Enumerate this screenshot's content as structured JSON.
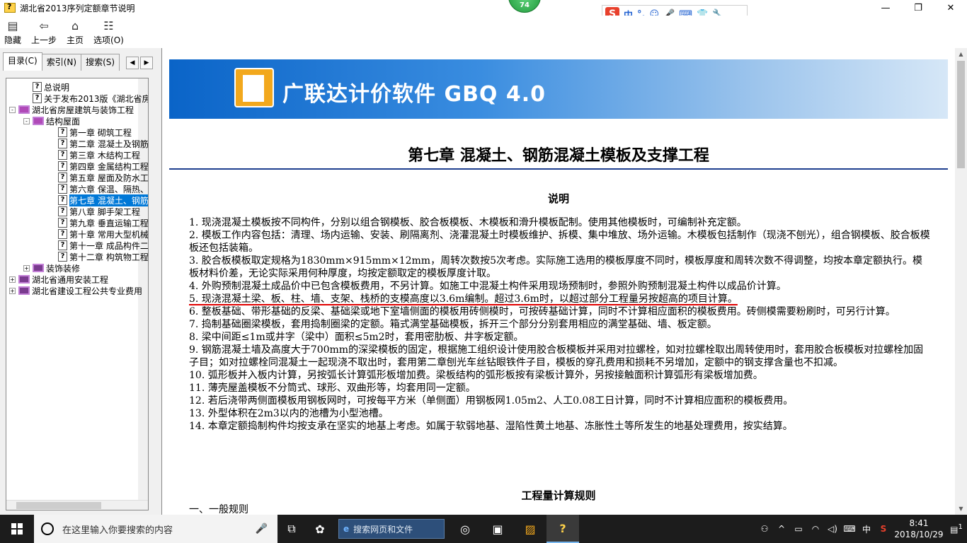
{
  "window": {
    "title": "湖北省2013序列定额章节说明",
    "badge": "74"
  },
  "ime": {
    "logo": "S",
    "items": [
      "中",
      "°,",
      "☺",
      "🎤",
      "⌨",
      "👕",
      "🔧"
    ]
  },
  "toolbar": {
    "buttons": [
      {
        "label": "隐藏",
        "icon": "hide-icon"
      },
      {
        "label": "上一步",
        "icon": "back-arrow-icon"
      },
      {
        "label": "主页",
        "icon": "home-icon"
      },
      {
        "label": "选项(O)",
        "icon": "options-icon"
      }
    ]
  },
  "nav": {
    "tabs": [
      "目录(C)",
      "索引(N)",
      "搜索(S)"
    ],
    "active_tab": "目录(C)",
    "tree": [
      {
        "label": "总说明",
        "type": "doc",
        "level": 1
      },
      {
        "label": "关于发布2013版《湖北省房屋",
        "type": "doc",
        "level": 1
      },
      {
        "label": "湖北省房屋建筑与装饰工程",
        "type": "book-open",
        "level": 0,
        "expander": "-"
      },
      {
        "label": "结构屋面",
        "type": "book-open",
        "level": 1,
        "expander": "-"
      },
      {
        "label": "第一章 砌筑工程",
        "type": "doc",
        "level": 2
      },
      {
        "label": "第二章 混凝土及钢筋混",
        "type": "doc",
        "level": 2
      },
      {
        "label": "第三章 木结构工程",
        "type": "doc",
        "level": 2
      },
      {
        "label": "第四章 金属结构工程",
        "type": "doc",
        "level": 2
      },
      {
        "label": "第五章 屋面及防水工程",
        "type": "doc",
        "level": 2
      },
      {
        "label": "第六章 保温、隔热、防",
        "type": "doc",
        "level": 2
      },
      {
        "label": "第七章 混凝土、钢筋混",
        "type": "doc",
        "level": 2,
        "selected": true
      },
      {
        "label": "第八章 脚手架工程",
        "type": "doc",
        "level": 2
      },
      {
        "label": "第九章 垂直运输工程",
        "type": "doc",
        "level": 2
      },
      {
        "label": "第十章 常用大型机械安",
        "type": "doc",
        "level": 2
      },
      {
        "label": "第十一章 成品构件二次",
        "type": "doc",
        "level": 2
      },
      {
        "label": "第十二章 构筑物工程",
        "type": "doc",
        "level": 2
      },
      {
        "label": "装饰装修",
        "type": "book",
        "level": 1,
        "expander": "+"
      },
      {
        "label": "湖北省通用安装工程",
        "type": "book",
        "level": 0,
        "expander": "+"
      },
      {
        "label": "湖北省建设工程公共专业费用",
        "type": "book",
        "level": 0,
        "expander": "+"
      }
    ]
  },
  "content": {
    "banner_text": "广联达计价软件 GBQ 4.0",
    "chapter_title": "第七章  混凝土、钢筋混凝土模板及支撑工程",
    "section_title": "说明",
    "paragraphs": [
      "1. 现浇混凝土模板按不同构件，分别以组合钢模板、胶合板模板、木模板和滑升模板配制。使用其他模板时，可编制补充定额。",
      "2. 模板工作内容包括：清理、场内运输、安装、刷隔离剂、浇灌混凝土时模板维护、拆模、集中堆放、场外运输。木模板包括制作（现浇不刨光），组合钢模板、胶合板模板还包括装箱。",
      "3. 胶合板模板取定规格为1830mm×915mm×12mm，周转次数按5次考虑。实际施工选用的模板厚度不同时，模板厚度和周转次数不得调整，均按本章定额执行。模板材料价差，无论实际采用何种厚度，均按定额取定的模板厚度计取。",
      "4. 外购预制混凝土成品价中已包含模板费用，不另计算。如施工中混凝土构件采用现场预制时，参照外购预制混凝土构件以成品价计算。",
      "5. 现浇混凝土梁、板、柱、墙、支架、栈桥的支模高度以3.6m编制。超过3.6m时，以超过部分工程量另按超高的项目计算。",
      "6. 整板基础、带形基础的反梁、基础梁或地下室墙侧面的模板用砖侧模时，可按砖基础计算，同时不计算相应面积的模板费用。砖侧模需要粉刷时，可另行计算。",
      "7. 捣制基础圈梁模板，套用捣制圈梁的定额。箱式满堂基础模板，拆开三个部分分别套用相应的满堂基础、墙、板定额。",
      "8. 梁中间距≤1m或井字（梁中）面积≤5m2时，套用密肋板、井字板定额。",
      "9. 钢筋混凝土墙及高度大于700mm的深梁模板的固定，根据施工组织设计使用胶合板模板并采用对拉螺栓，如对拉螺栓取出周转使用时，套用胶合板模板对拉螺栓加固子目；如对拉螺栓同混凝土一起现浇不取出时，套用第二章刨光车丝钻眼铁件子目，模板的穿孔费用和损耗不另增加，定额中的钢支撑含量也不扣减。",
      "10. 弧形板并入板内计算，另按弧长计算弧形板增加费。梁板结构的弧形板按有梁板计算外，另按接触面积计算弧形有梁板增加费。",
      "11. 薄壳屋盖模板不分筒式、球形、双曲形等，均套用同一定额。",
      "12. 若后浇带两侧面模板用钢板网时，可按每平方米（单侧面）用钢板网1.05m2、人工0.08工日计算，同时不计算相应面积的模板费用。",
      "13. 外型体积在2m3以内的池槽为小型池槽。",
      "14. 本章定额捣制构件均按支承在坚实的地基上考虑。如属于软弱地基、湿陷性黄土地基、冻胀性土等所发生的地基处理费用，按实结算。"
    ],
    "underlined_index": 4,
    "section2_title": "工程量计算规则",
    "section2_sub": "一、一般规则"
  },
  "taskbar": {
    "search_placeholder": "在这里输入你要搜索的内容",
    "browser_search": "搜索网页和文件",
    "tray_lang": "中",
    "time": "8:41",
    "date": "2018/10/29",
    "notifications": "1"
  },
  "colors": {
    "selection": "#0078d7",
    "title_rule": "#1f3f8f",
    "underline": "#e00000",
    "taskbar": "#1c1c1c"
  }
}
